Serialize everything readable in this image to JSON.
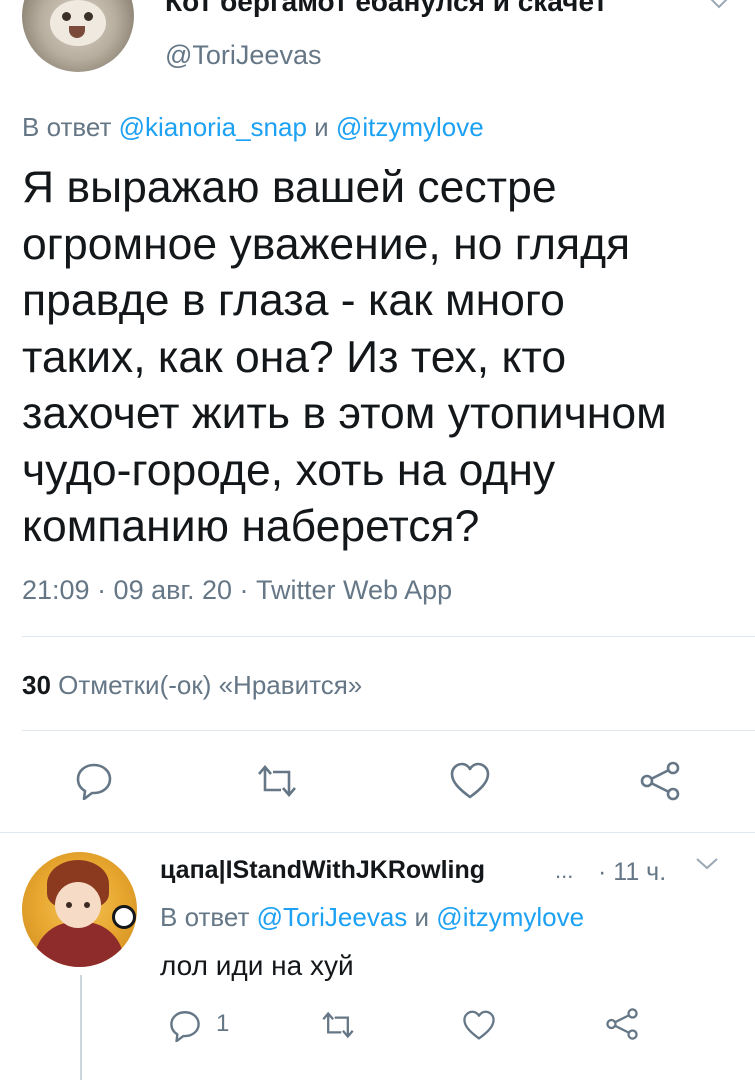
{
  "tweet": {
    "author_name": "Кот бергамот ебанулся и скачет",
    "author_handle": "@ToriJeevas",
    "reply_prefix": "В ответ",
    "reply_user1": "@kianoria_snap",
    "reply_and": "и",
    "reply_user2": "@itzymylove",
    "lines": [
      "Я выражаю вашей сестре",
      "огромное уважение, но глядя",
      "правде в глаза - как много",
      "таких, как она? Из тех, кто",
      "захочет жить в этом утопичном",
      "чудо-городе, хоть на одну",
      "компанию наберется?"
    ],
    "meta": "21:09 · 09 авг. 20 · Twitter Web App",
    "likes_count": "30",
    "likes_label": "Отметки(-ок) «Нравится»"
  },
  "reply": {
    "author_name": "цапа|IStandWithJKRowling",
    "ellipsis": "...",
    "time": "· 11 ч.",
    "reply_prefix": "В ответ",
    "reply_user1": "@ToriJeevas",
    "reply_and": "и",
    "reply_user2": "@itzymylove",
    "text": "лол иди на хуй",
    "reply_count": "1"
  },
  "icons": {
    "reply": "reply-icon",
    "retweet": "retweet-icon",
    "like": "heart-icon",
    "share": "share-icon",
    "more": "chevron-down-icon"
  },
  "colors": {
    "link": "#1da1f2",
    "muted": "#657786",
    "text": "#14171a"
  }
}
